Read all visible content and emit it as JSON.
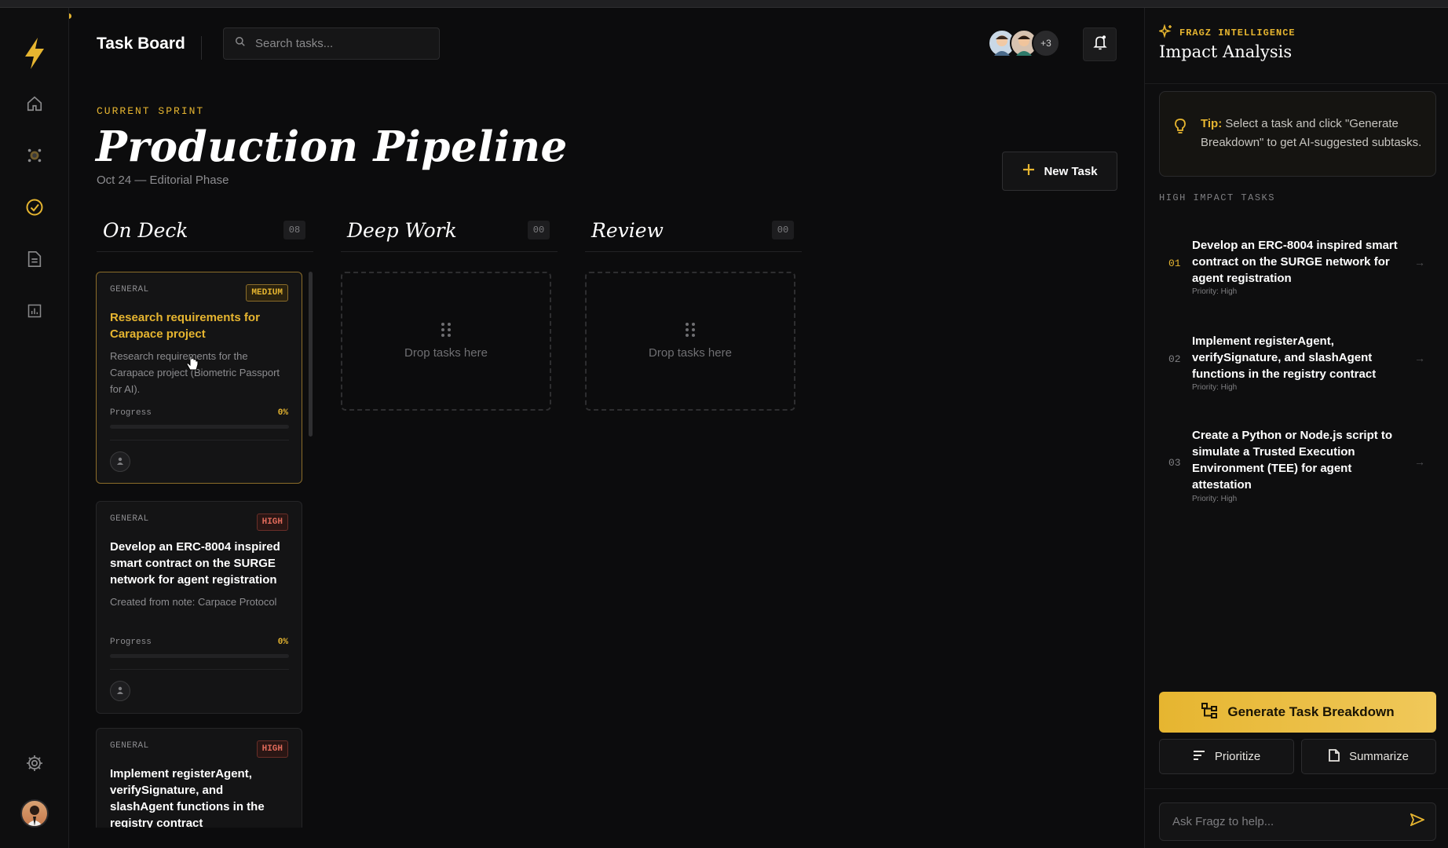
{
  "header": {
    "title": "Task Board",
    "search_placeholder": "Search tasks...",
    "collaborators_more": "+3"
  },
  "hero": {
    "eyebrow": "CURRENT SPRINT",
    "title": "Production Pipeline",
    "subtitle": "Oct 24 — Editorial Phase",
    "new_task_label": "New Task"
  },
  "columns": [
    {
      "name": "On Deck",
      "count": "08"
    },
    {
      "name": "Deep Work",
      "count": "00",
      "drop_label": "Drop tasks here"
    },
    {
      "name": "Review",
      "count": "00",
      "drop_label": "Drop tasks here"
    }
  ],
  "cards": [
    {
      "category": "GENERAL",
      "priority": "MEDIUM",
      "title": "Research requirements for Carapace project",
      "description": "Research requirements for the Carapace project (Biometric Passport for AI).",
      "progress_label": "Progress",
      "progress": "0%"
    },
    {
      "category": "GENERAL",
      "priority": "HIGH",
      "title": "Develop an ERC-8004 inspired smart contract on the SURGE network for agent registration",
      "description": "Created from note: Carpace Protocol",
      "progress_label": "Progress",
      "progress": "0%"
    },
    {
      "category": "GENERAL",
      "priority": "HIGH",
      "title": "Implement registerAgent, verifySignature, and slashAgent functions in the registry contract"
    }
  ],
  "panel": {
    "kicker": "FRAGZ INTELLIGENCE",
    "title": "Impact Analysis",
    "tip_label": "Tip:",
    "tip_text": "Select a task and click \"Generate Breakdown\" to get AI-suggested subtasks.",
    "section_label": "HIGH IMPACT TASKS",
    "impact_tasks": [
      {
        "num": "01",
        "title": "Develop an ERC-8004 inspired smart contract on the SURGE network for agent registration",
        "priority": "Priority: High"
      },
      {
        "num": "02",
        "title": "Implement registerAgent, verifySignature, and slashAgent functions in the registry contract",
        "priority": "Priority: High"
      },
      {
        "num": "03",
        "title": "Create a Python or Node.js script to simulate a Trusted Execution Environment (TEE) for agent attestation",
        "priority": "Priority: High"
      }
    ],
    "generate_label": "Generate Task Breakdown",
    "prioritize_label": "Prioritize",
    "summarize_label": "Summarize",
    "ask_placeholder": "Ask Fragz to help..."
  },
  "colors": {
    "accent": "#e6b530",
    "background": "#0c0c0d",
    "high_priority": "#e06a5a"
  },
  "icons": [
    "bolt-icon",
    "home-icon",
    "brain-icon",
    "check-circle-icon",
    "document-icon",
    "chart-icon",
    "gear-icon",
    "search-icon",
    "bell-icon",
    "plus-icon",
    "sparkle-icon",
    "bulb-icon",
    "hierarchy-icon",
    "sort-icon",
    "note-icon",
    "send-icon",
    "user-icon",
    "grip-icon",
    "arrow-right-icon"
  ]
}
